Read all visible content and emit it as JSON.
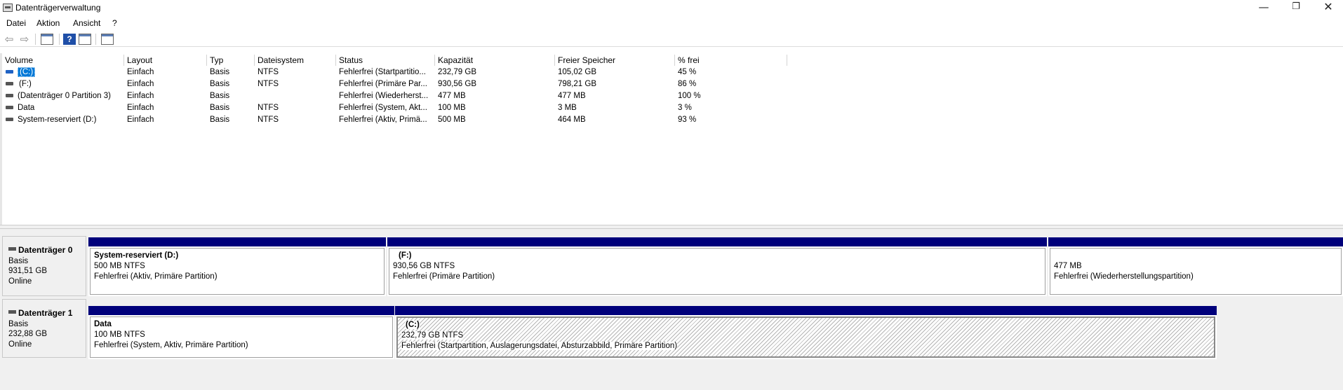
{
  "window": {
    "title": "Datenträgerverwaltung",
    "minimize_glyph": "—",
    "restore_glyph": "❐",
    "close_glyph": "✕"
  },
  "menu": [
    {
      "label": "Datei"
    },
    {
      "label": "Aktion"
    },
    {
      "label": "Ansicht"
    },
    {
      "label": "?"
    }
  ],
  "toolbar": {
    "icons": [
      "back-arrow-icon",
      "forward-arrow-icon",
      "console-tree-icon",
      "help-icon",
      "properties-icon",
      "settings-list-icon"
    ],
    "back_glyph": "⇦",
    "forward_glyph": "⇨",
    "help_glyph": "?"
  },
  "volume_list": {
    "columns": [
      "Volume",
      "Layout",
      "Typ",
      "Dateisystem",
      "Status",
      "Kapazität",
      "Freier Speicher",
      "% frei"
    ],
    "rows": [
      {
        "volume": "(C:)",
        "layout": "Einfach",
        "typ": "Basis",
        "fs": "NTFS",
        "status": "Fehlerfrei (Startpartitio...",
        "capacity": "232,79 GB",
        "free": "105,02 GB",
        "pct": "45 %",
        "selected": true
      },
      {
        "volume": "(F:)",
        "layout": "Einfach",
        "typ": "Basis",
        "fs": "NTFS",
        "status": "Fehlerfrei (Primäre Par...",
        "capacity": "930,56 GB",
        "free": "798,21 GB",
        "pct": "86 %"
      },
      {
        "volume": "(Datenträger 0 Partition 3)",
        "layout": "Einfach",
        "typ": "Basis",
        "fs": "",
        "status": "Fehlerfrei (Wiederherst...",
        "capacity": "477 MB",
        "free": "477 MB",
        "pct": "100 %"
      },
      {
        "volume": "Data",
        "layout": "Einfach",
        "typ": "Basis",
        "fs": "NTFS",
        "status": "Fehlerfrei (System, Akt...",
        "capacity": "100 MB",
        "free": "3 MB",
        "pct": "3 %"
      },
      {
        "volume": "System-reserviert (D:)",
        "layout": "Einfach",
        "typ": "Basis",
        "fs": "NTFS",
        "status": "Fehlerfrei (Aktiv, Primä...",
        "capacity": "500 MB",
        "free": "464 MB",
        "pct": "93 %"
      }
    ]
  },
  "disks": [
    {
      "name": "Datenträger 0",
      "type": "Basis",
      "size": "931,51 GB",
      "state": "Online",
      "partitions": [
        {
          "name": "System-reserviert  (D:)",
          "size": "500 MB NTFS",
          "status": "Fehlerfrei (Aktiv, Primäre Partition)"
        },
        {
          "name": "(F:)",
          "size": "930,56 GB NTFS",
          "status": "Fehlerfrei (Primäre Partition)"
        },
        {
          "name": "",
          "size": "477 MB",
          "status": "Fehlerfrei (Wiederherstellungspartition)"
        }
      ]
    },
    {
      "name": "Datenträger 1",
      "type": "Basis",
      "size": "232,88 GB",
      "state": "Online",
      "partitions": [
        {
          "name": "Data",
          "size": "100 MB NTFS",
          "status": "Fehlerfrei (System, Aktiv, Primäre Partition)"
        },
        {
          "name": "(C:)",
          "size": "232,79 GB NTFS",
          "status": "Fehlerfrei (Startpartition, Auslagerungsdatei, Absturzabbild, Primäre Partition)",
          "selected": true
        }
      ]
    }
  ],
  "colors": {
    "partition_bar": "#00007b",
    "selection": "#0078d7"
  }
}
